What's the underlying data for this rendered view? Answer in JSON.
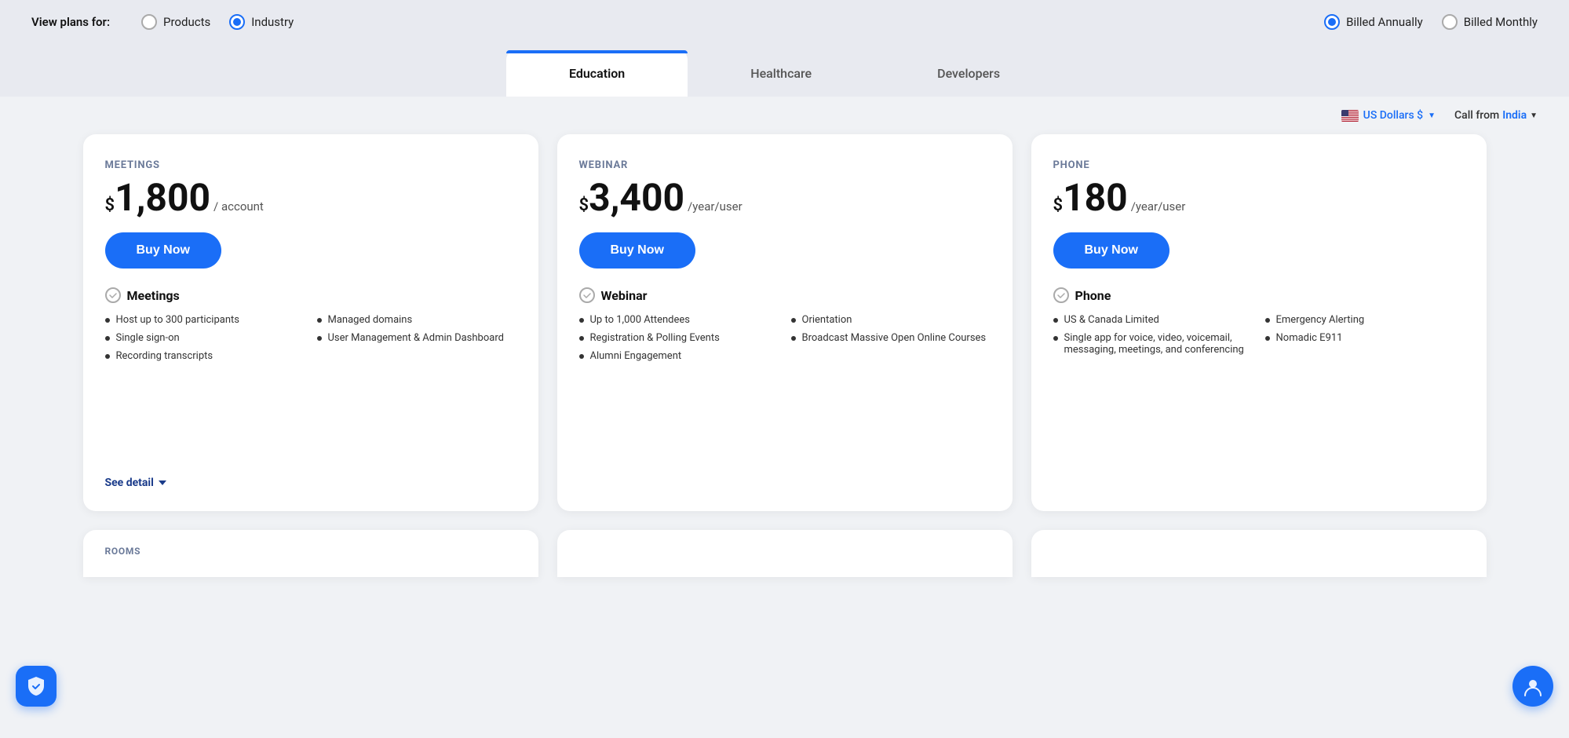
{
  "topbar": {
    "view_plans_label": "View plans for:",
    "products_label": "Products",
    "industry_label": "Industry",
    "billed_annually_label": "Billed Annually",
    "billed_monthly_label": "Billed Monthly"
  },
  "tabs": [
    {
      "id": "education",
      "label": "Education",
      "active": true
    },
    {
      "id": "healthcare",
      "label": "Healthcare",
      "active": false
    },
    {
      "id": "developers",
      "label": "Developers",
      "active": false
    }
  ],
  "currency_bar": {
    "currency_label": "US Dollars $",
    "call_from_prefix": "Call from",
    "call_from_location": "India"
  },
  "plans": [
    {
      "id": "meetings",
      "type_label": "MEETINGS",
      "price_symbol": "$",
      "price_amount": "1,800",
      "price_period": "/ account",
      "buy_label": "Buy Now",
      "feature_title": "Meetings",
      "features_left": [
        "Host up to 300 participants",
        "Single sign-on",
        "Recording transcripts"
      ],
      "features_right": [
        "Managed domains",
        "User Management & Admin Dashboard"
      ],
      "see_detail_label": "See detail"
    },
    {
      "id": "webinar",
      "type_label": "WEBINAR",
      "price_symbol": "$",
      "price_amount": "3,400",
      "price_period": "/year/user",
      "buy_label": "Buy Now",
      "feature_title": "Webinar",
      "features_left": [
        "Up to 1,000 Attendees",
        "Registration & Polling Events",
        "Alumni Engagement"
      ],
      "features_right": [
        "Orientation",
        "Broadcast Massive Open Online Courses"
      ],
      "see_detail_label": ""
    },
    {
      "id": "phone",
      "type_label": "PHONE",
      "price_symbol": "$",
      "price_amount": "180",
      "price_period": "/year/user",
      "buy_label": "Buy Now",
      "feature_title": "Phone",
      "features_left": [
        "US & Canada Limited",
        "Single app for voice, video, voicemail, messaging, meetings, and conferencing"
      ],
      "features_right": [
        "Emergency Alerting",
        "Nomadic E911"
      ],
      "see_detail_label": ""
    }
  ],
  "bottom_partials": [
    {
      "label": "ROOMS"
    },
    {
      "label": ""
    },
    {
      "label": ""
    }
  ]
}
